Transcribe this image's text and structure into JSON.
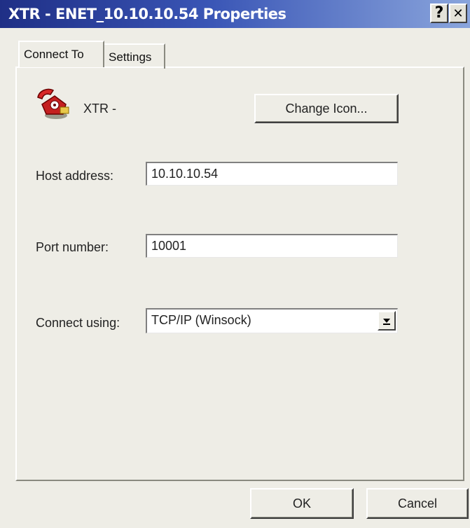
{
  "window": {
    "title": "XTR - ENET_10.10.10.54 Properties",
    "help_label": "?",
    "close_label": "✕"
  },
  "tabs": [
    {
      "label": "Connect To",
      "active": true
    },
    {
      "label": "Settings",
      "active": false
    }
  ],
  "connection": {
    "name": "XTR -",
    "icon": "telephone-icon",
    "change_icon_label": "Change Icon..."
  },
  "fields": {
    "host_label": "Host address:",
    "host_value": "10.10.10.54",
    "port_label": "Port number:",
    "port_value": "10001",
    "connect_label": "Connect using:",
    "connect_value": "TCP/IP (Winsock)"
  },
  "buttons": {
    "ok_label": "OK",
    "cancel_label": "Cancel"
  },
  "colors": {
    "titlebar_start": "#1f2f86",
    "titlebar_end": "#8aa5dc",
    "dialog_bg": "#eeede6"
  }
}
